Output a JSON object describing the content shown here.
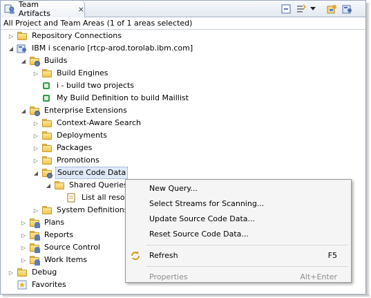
{
  "view": {
    "tab_title": "Team Artifacts",
    "close_glyph": "⨯",
    "filter_text": "All Project and Team Areas (1 of 1 areas selected)"
  },
  "toolbar": {
    "icons": [
      "collapse-all-icon",
      "link-with-editor-icon",
      "view-menu-icon",
      "team-area-icon",
      "project-area-icon"
    ]
  },
  "tree": {
    "nodes": [
      {
        "label": "Repository Connections",
        "depth": 0,
        "expander": "collapsed",
        "icon": "folder-icon"
      },
      {
        "label": "IBM i scenario [rtcp-arod.torolab.ibm.com]",
        "depth": 0,
        "expander": "expanded",
        "icon": "project-area-icon"
      },
      {
        "label": "Builds",
        "depth": 1,
        "expander": "expanded",
        "icon": "builds-folder-icon"
      },
      {
        "label": "Build Engines",
        "depth": 2,
        "expander": "collapsed",
        "icon": "folder-icon"
      },
      {
        "label": "i - build two projects",
        "depth": 2,
        "expander": "none",
        "icon": "build-definition-icon"
      },
      {
        "label": "My Build Definition to build Maillist",
        "depth": 2,
        "expander": "none",
        "icon": "build-definition-icon"
      },
      {
        "label": "Enterprise Extensions",
        "depth": 1,
        "expander": "expanded",
        "icon": "enterprise-folder-icon"
      },
      {
        "label": "Context-Aware Search",
        "depth": 2,
        "expander": "collapsed",
        "icon": "folder-icon"
      },
      {
        "label": "Deployments",
        "depth": 2,
        "expander": "collapsed",
        "icon": "folder-icon"
      },
      {
        "label": "Packages",
        "depth": 2,
        "expander": "collapsed",
        "icon": "folder-icon"
      },
      {
        "label": "Promotions",
        "depth": 2,
        "expander": "collapsed",
        "icon": "folder-icon"
      },
      {
        "label": "Source Code Data",
        "depth": 2,
        "expander": "expanded",
        "icon": "source-code-data-icon",
        "selected": true
      },
      {
        "label": "Shared Queries",
        "depth": 3,
        "expander": "expanded",
        "icon": "folder-icon"
      },
      {
        "label": "List all reso",
        "depth": 4,
        "expander": "none",
        "icon": "query-icon"
      },
      {
        "label": "System Definitions",
        "depth": 2,
        "expander": "collapsed",
        "icon": "folder-icon"
      },
      {
        "label": "Plans",
        "depth": 1,
        "expander": "collapsed",
        "icon": "plans-folder-icon"
      },
      {
        "label": "Reports",
        "depth": 1,
        "expander": "collapsed",
        "icon": "reports-folder-icon"
      },
      {
        "label": "Source Control",
        "depth": 1,
        "expander": "collapsed",
        "icon": "source-control-folder-icon"
      },
      {
        "label": "Work Items",
        "depth": 1,
        "expander": "collapsed",
        "icon": "work-items-folder-icon"
      },
      {
        "label": "Debug",
        "depth": 0,
        "expander": "collapsed",
        "icon": "folder-icon"
      },
      {
        "label": "Favorites",
        "depth": 0,
        "expander": "none",
        "icon": "favorites-icon"
      }
    ]
  },
  "context_menu": {
    "items": [
      {
        "label": "New Query...",
        "shortcut": "",
        "enabled": true
      },
      {
        "label": "Select Streams for Scanning...",
        "shortcut": "",
        "enabled": true
      },
      {
        "label": "Update Source Code Data...",
        "shortcut": "",
        "enabled": true
      },
      {
        "label": "Reset Source Code Data...",
        "shortcut": "",
        "enabled": true
      },
      {
        "separator": true
      },
      {
        "label": "Refresh",
        "shortcut": "F5",
        "enabled": true,
        "icon": "refresh-icon"
      },
      {
        "separator": true
      },
      {
        "label": "Properties",
        "shortcut": "Alt+Enter",
        "enabled": false
      }
    ]
  },
  "colors": {
    "selection": "#dfe9f6",
    "menu_bg": "#f5f5f5",
    "disabled_text": "#8d8d8d"
  }
}
